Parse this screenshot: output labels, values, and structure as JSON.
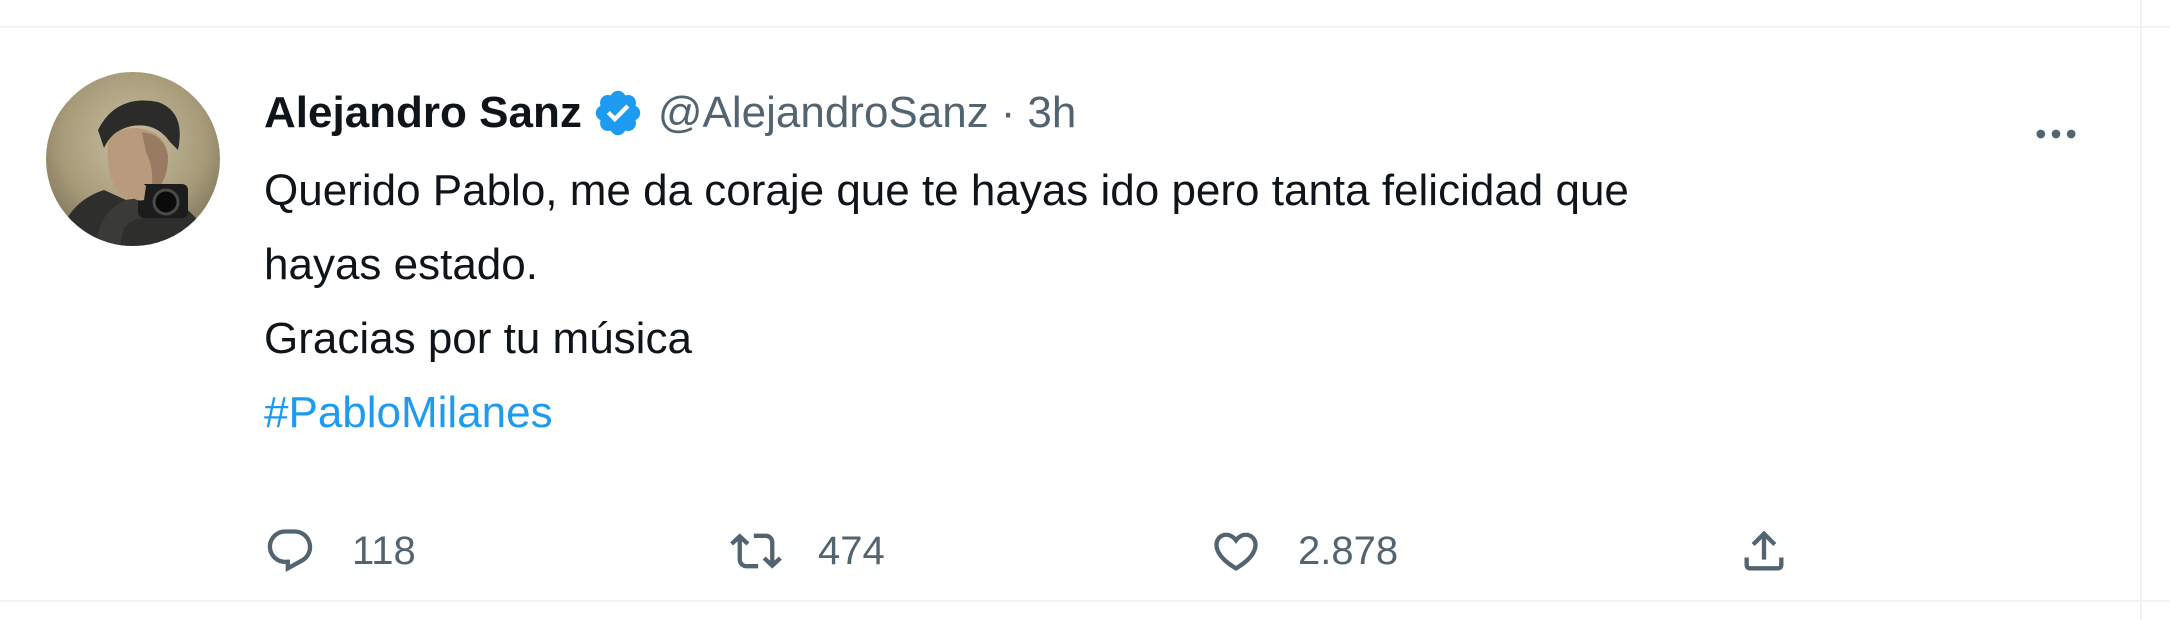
{
  "tweet": {
    "author": {
      "display_name": "Alejandro Sanz",
      "handle": "@AlejandroSanz",
      "verified": true
    },
    "separator": "·",
    "time": "3h",
    "text_lines": [
      "Querido Pablo, me da coraje que te hayas ido pero tanta felicidad que",
      "hayas estado.",
      "Gracias por tu música"
    ],
    "hashtag": "#PabloMilanes",
    "actions": {
      "reply": {
        "icon": "reply-icon",
        "count": "118"
      },
      "retweet": {
        "icon": "retweet-icon",
        "count": "474"
      },
      "like": {
        "icon": "heart-icon",
        "count": "2.878"
      },
      "share": {
        "icon": "share-icon"
      }
    },
    "more_icon": "more-icon"
  },
  "colors": {
    "text": "#0f1419",
    "secondary": "#536471",
    "accent": "#1d9bf0",
    "border": "#eff3f4"
  }
}
